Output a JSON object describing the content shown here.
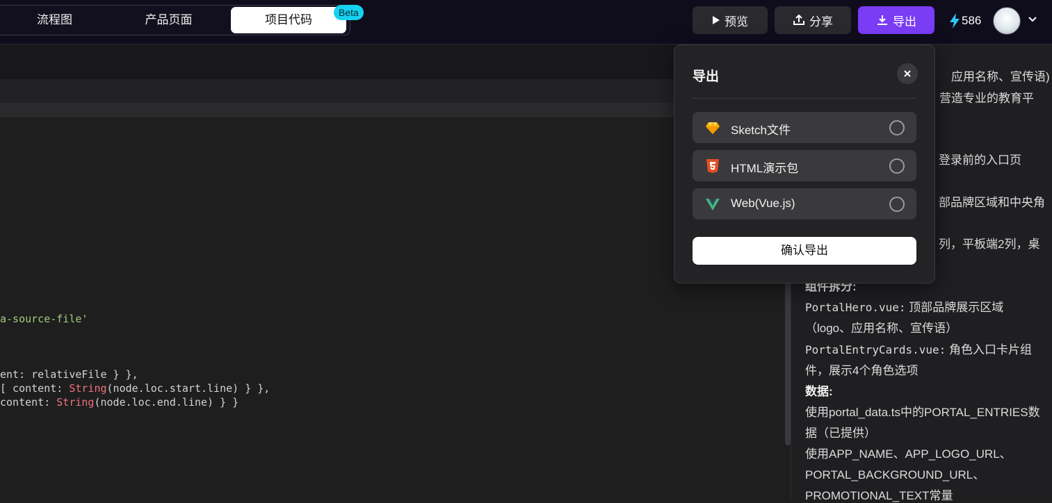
{
  "tabs": [
    {
      "label": "流程图"
    },
    {
      "label": "产品页面"
    },
    {
      "label": "项目代码"
    }
  ],
  "beta_badge": "Beta",
  "toolbar": {
    "preview_label": "预览",
    "share_label": "分享",
    "export_label": "导出",
    "credits": "586"
  },
  "code_lines": [
    {
      "plain": "a-source-file'",
      "str": true
    },
    {
      "prefix": "ent: relativeFile } },"
    },
    {
      "prefix": "[ content: ",
      "fn": "String",
      "suffix": "(node.loc.start.line) } },"
    },
    {
      "prefix": "content: ",
      "fn": "String",
      "suffix": "(node.loc.end.line) } }"
    }
  ],
  "doc": {
    "lines": [
      "应用名称、宣传语)",
      "营造专业的教育平",
      "登录前的入口页",
      "部品牌区域和中央角",
      "列，平板端2列，桌",
      "组件拆分:",
      "顶部品牌展示区域",
      "（logo、应用名称、宣传语）",
      "角色入口卡片组",
      "件，展示4个角色选项",
      "数据:",
      "使用portal_data.ts中的PORTAL_ENTRIES数",
      "据（已提供）",
      "使用APP_NAME、APP_LOGO_URL、",
      "PORTAL_BACKGROUND_URL、",
      "PROMOTIONAL_TEXT常量"
    ],
    "component_hero": "PortalHero.vue:",
    "component_cards": "PortalEntryCards.vue:"
  },
  "modal": {
    "title": "导出",
    "options": [
      {
        "label": "Sketch文件",
        "icon": "sketch-icon",
        "color": "#f7b500"
      },
      {
        "label": "HTML演示包",
        "icon": "html5-icon",
        "color": "#e34f26"
      },
      {
        "label": "Web(Vue.js)",
        "icon": "vue-icon",
        "color": "#41b883"
      }
    ],
    "confirm_label": "确认导出"
  },
  "colors": {
    "accent": "#7a3cf5",
    "beta": "#14d3f2"
  }
}
